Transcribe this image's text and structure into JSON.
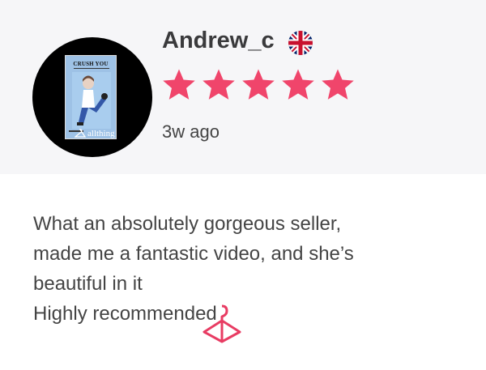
{
  "review": {
    "username": "Andrew_c",
    "flag_icon": "uk-flag-icon",
    "rating": 5,
    "rating_max": 5,
    "time_ago": "3w ago",
    "avatar": {
      "cover_title": "CRUSH YOU",
      "brand": "allthing"
    },
    "lines": [
      "What an absolutely gorgeous seller,",
      "made me a fantastic video, and she’s",
      "beautiful in it",
      "Highly recommended"
    ]
  },
  "colors": {
    "star": "#f0456b",
    "header_bg": "#f6f6f8",
    "watermark": "#e83c63"
  },
  "watermark_icon": "hanger-watermark-icon"
}
